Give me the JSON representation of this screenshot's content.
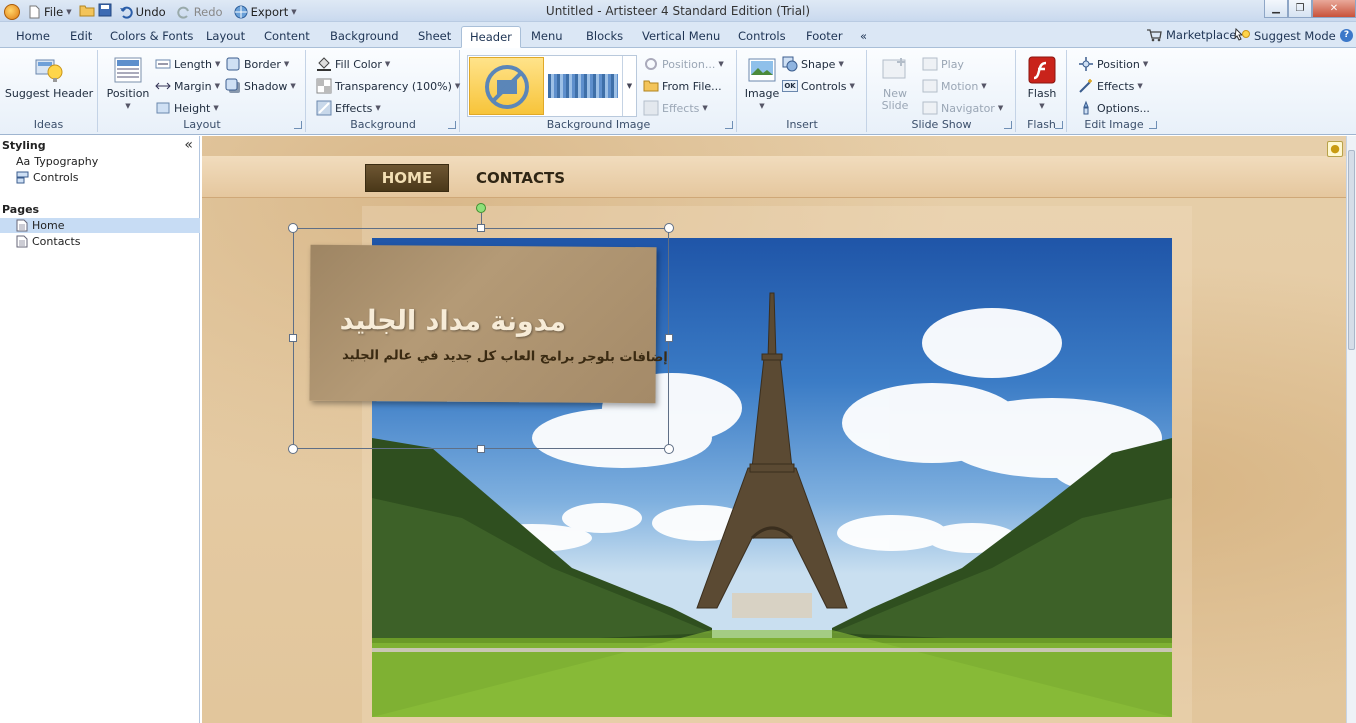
{
  "window": {
    "title": "Untitled - Artisteer 4 Standard Edition (Trial)"
  },
  "qat": {
    "file": "File",
    "undo": "Undo",
    "redo": "Redo",
    "export": "Export"
  },
  "tabs": [
    "Home",
    "Edit",
    "Colors & Fonts",
    "Layout",
    "Content",
    "Background",
    "Sheet",
    "Header",
    "Menu",
    "Blocks",
    "Vertical Menu",
    "Controls",
    "Footer"
  ],
  "tabs_right": {
    "marketplace": "Marketplace",
    "suggest_mode": "Suggest Mode"
  },
  "ribbon": {
    "ideas": {
      "label": "Ideas",
      "suggest": "Suggest Header"
    },
    "layout": {
      "label": "Layout",
      "position": "Position",
      "length": "Length",
      "margin": "Margin",
      "height": "Height",
      "border": "Border",
      "shadow": "Shadow"
    },
    "background": {
      "label": "Background",
      "fill_color": "Fill Color",
      "transparency": "Transparency (100%)",
      "effects": "Effects"
    },
    "background_image": {
      "label": "Background Image",
      "position": "Position...",
      "from_file": "From File...",
      "effects": "Effects"
    },
    "insert": {
      "label": "Insert",
      "image": "Image",
      "shape": "Shape",
      "controls": "Controls"
    },
    "slideshow": {
      "label": "Slide Show",
      "new_slide": "New Slide",
      "play": "Play",
      "motion": "Motion",
      "navigator": "Navigator"
    },
    "flash": {
      "label": "Flash",
      "flash": "Flash"
    },
    "edit_image": {
      "label": "Edit Image",
      "position": "Position",
      "effects": "Effects",
      "options": "Options..."
    }
  },
  "left_panel": {
    "styling_header": "Styling",
    "styling_items": [
      {
        "label": "Typography",
        "prefix": "Aa"
      },
      {
        "label": "Controls"
      }
    ],
    "pages_header": "Pages",
    "pages": [
      "Home",
      "Contacts"
    ]
  },
  "site": {
    "menu": [
      "HOME",
      "CONTACTS"
    ],
    "headline": "مدونة مداد الجليد",
    "slogan": "إضافات بلوجر برامج العاب كل جديد في عالم الجليد"
  },
  "colors": {
    "accent": "#f5c24a",
    "ribbon_bg": "#e8f0f9",
    "paper": "#e4cba4",
    "menu_active": "#5a4526"
  }
}
